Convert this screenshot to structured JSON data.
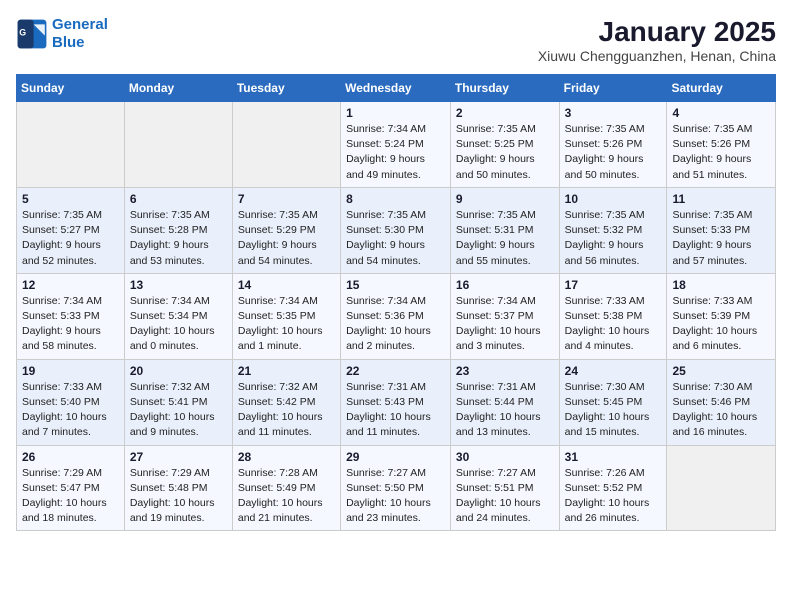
{
  "logo": {
    "line1": "General",
    "line2": "Blue"
  },
  "title": "January 2025",
  "subtitle": "Xiuwu Chengguanzhen, Henan, China",
  "days_of_week": [
    "Sunday",
    "Monday",
    "Tuesday",
    "Wednesday",
    "Thursday",
    "Friday",
    "Saturday"
  ],
  "weeks": [
    [
      {
        "num": "",
        "info": ""
      },
      {
        "num": "",
        "info": ""
      },
      {
        "num": "",
        "info": ""
      },
      {
        "num": "1",
        "info": "Sunrise: 7:34 AM\nSunset: 5:24 PM\nDaylight: 9 hours\nand 49 minutes."
      },
      {
        "num": "2",
        "info": "Sunrise: 7:35 AM\nSunset: 5:25 PM\nDaylight: 9 hours\nand 50 minutes."
      },
      {
        "num": "3",
        "info": "Sunrise: 7:35 AM\nSunset: 5:26 PM\nDaylight: 9 hours\nand 50 minutes."
      },
      {
        "num": "4",
        "info": "Sunrise: 7:35 AM\nSunset: 5:26 PM\nDaylight: 9 hours\nand 51 minutes."
      }
    ],
    [
      {
        "num": "5",
        "info": "Sunrise: 7:35 AM\nSunset: 5:27 PM\nDaylight: 9 hours\nand 52 minutes."
      },
      {
        "num": "6",
        "info": "Sunrise: 7:35 AM\nSunset: 5:28 PM\nDaylight: 9 hours\nand 53 minutes."
      },
      {
        "num": "7",
        "info": "Sunrise: 7:35 AM\nSunset: 5:29 PM\nDaylight: 9 hours\nand 54 minutes."
      },
      {
        "num": "8",
        "info": "Sunrise: 7:35 AM\nSunset: 5:30 PM\nDaylight: 9 hours\nand 54 minutes."
      },
      {
        "num": "9",
        "info": "Sunrise: 7:35 AM\nSunset: 5:31 PM\nDaylight: 9 hours\nand 55 minutes."
      },
      {
        "num": "10",
        "info": "Sunrise: 7:35 AM\nSunset: 5:32 PM\nDaylight: 9 hours\nand 56 minutes."
      },
      {
        "num": "11",
        "info": "Sunrise: 7:35 AM\nSunset: 5:33 PM\nDaylight: 9 hours\nand 57 minutes."
      }
    ],
    [
      {
        "num": "12",
        "info": "Sunrise: 7:34 AM\nSunset: 5:33 PM\nDaylight: 9 hours\nand 58 minutes."
      },
      {
        "num": "13",
        "info": "Sunrise: 7:34 AM\nSunset: 5:34 PM\nDaylight: 10 hours\nand 0 minutes."
      },
      {
        "num": "14",
        "info": "Sunrise: 7:34 AM\nSunset: 5:35 PM\nDaylight: 10 hours\nand 1 minute."
      },
      {
        "num": "15",
        "info": "Sunrise: 7:34 AM\nSunset: 5:36 PM\nDaylight: 10 hours\nand 2 minutes."
      },
      {
        "num": "16",
        "info": "Sunrise: 7:34 AM\nSunset: 5:37 PM\nDaylight: 10 hours\nand 3 minutes."
      },
      {
        "num": "17",
        "info": "Sunrise: 7:33 AM\nSunset: 5:38 PM\nDaylight: 10 hours\nand 4 minutes."
      },
      {
        "num": "18",
        "info": "Sunrise: 7:33 AM\nSunset: 5:39 PM\nDaylight: 10 hours\nand 6 minutes."
      }
    ],
    [
      {
        "num": "19",
        "info": "Sunrise: 7:33 AM\nSunset: 5:40 PM\nDaylight: 10 hours\nand 7 minutes."
      },
      {
        "num": "20",
        "info": "Sunrise: 7:32 AM\nSunset: 5:41 PM\nDaylight: 10 hours\nand 9 minutes."
      },
      {
        "num": "21",
        "info": "Sunrise: 7:32 AM\nSunset: 5:42 PM\nDaylight: 10 hours\nand 11 minutes."
      },
      {
        "num": "22",
        "info": "Sunrise: 7:31 AM\nSunset: 5:43 PM\nDaylight: 10 hours\nand 11 minutes."
      },
      {
        "num": "23",
        "info": "Sunrise: 7:31 AM\nSunset: 5:44 PM\nDaylight: 10 hours\nand 13 minutes."
      },
      {
        "num": "24",
        "info": "Sunrise: 7:30 AM\nSunset: 5:45 PM\nDaylight: 10 hours\nand 15 minutes."
      },
      {
        "num": "25",
        "info": "Sunrise: 7:30 AM\nSunset: 5:46 PM\nDaylight: 10 hours\nand 16 minutes."
      }
    ],
    [
      {
        "num": "26",
        "info": "Sunrise: 7:29 AM\nSunset: 5:47 PM\nDaylight: 10 hours\nand 18 minutes."
      },
      {
        "num": "27",
        "info": "Sunrise: 7:29 AM\nSunset: 5:48 PM\nDaylight: 10 hours\nand 19 minutes."
      },
      {
        "num": "28",
        "info": "Sunrise: 7:28 AM\nSunset: 5:49 PM\nDaylight: 10 hours\nand 21 minutes."
      },
      {
        "num": "29",
        "info": "Sunrise: 7:27 AM\nSunset: 5:50 PM\nDaylight: 10 hours\nand 23 minutes."
      },
      {
        "num": "30",
        "info": "Sunrise: 7:27 AM\nSunset: 5:51 PM\nDaylight: 10 hours\nand 24 minutes."
      },
      {
        "num": "31",
        "info": "Sunrise: 7:26 AM\nSunset: 5:52 PM\nDaylight: 10 hours\nand 26 minutes."
      },
      {
        "num": "",
        "info": ""
      }
    ]
  ]
}
